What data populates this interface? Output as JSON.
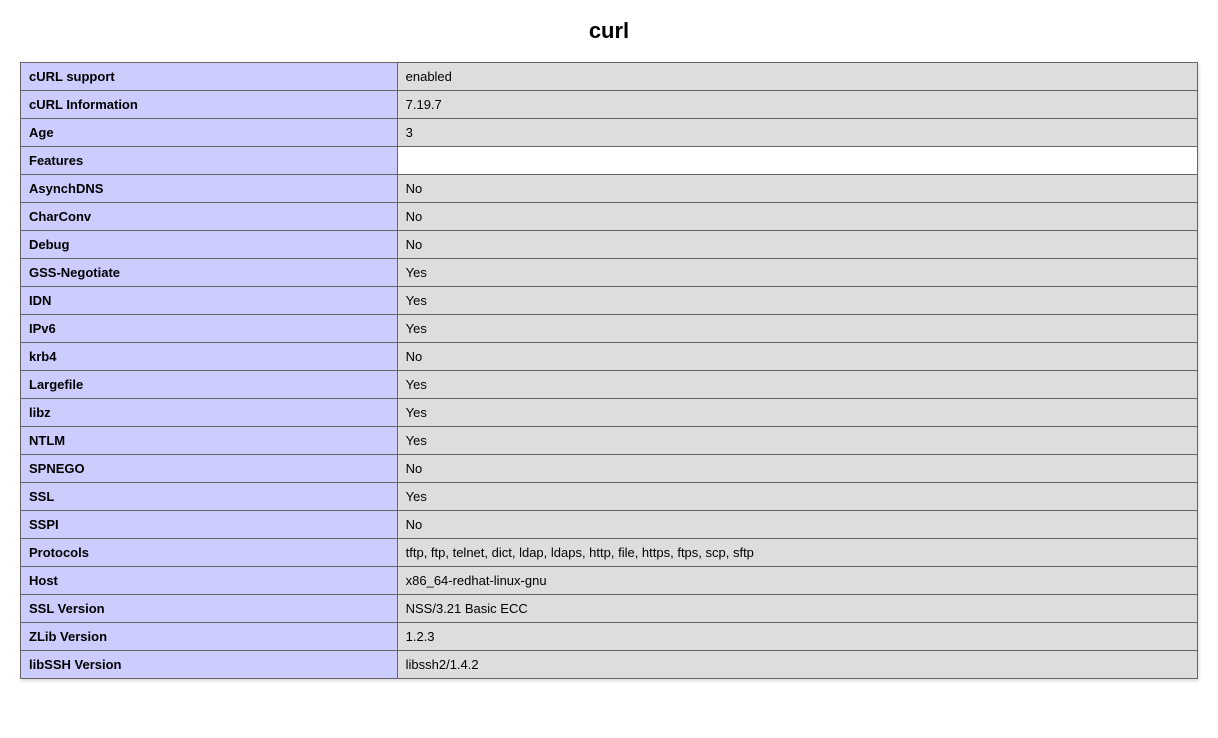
{
  "title": "curl",
  "rows": [
    {
      "key": "cURL support",
      "value": "enabled"
    },
    {
      "key": "cURL Information",
      "value": "7.19.7"
    },
    {
      "key": "Age",
      "value": "3"
    },
    {
      "key": "Features",
      "value": "",
      "empty": true
    },
    {
      "key": "AsynchDNS",
      "value": "No"
    },
    {
      "key": "CharConv",
      "value": "No"
    },
    {
      "key": "Debug",
      "value": "No"
    },
    {
      "key": "GSS-Negotiate",
      "value": "Yes"
    },
    {
      "key": "IDN",
      "value": "Yes"
    },
    {
      "key": "IPv6",
      "value": "Yes"
    },
    {
      "key": "krb4",
      "value": "No"
    },
    {
      "key": "Largefile",
      "value": "Yes"
    },
    {
      "key": "libz",
      "value": "Yes"
    },
    {
      "key": "NTLM",
      "value": "Yes"
    },
    {
      "key": "SPNEGO",
      "value": "No"
    },
    {
      "key": "SSL",
      "value": "Yes"
    },
    {
      "key": "SSPI",
      "value": "No"
    },
    {
      "key": "Protocols",
      "value": "tftp, ftp, telnet, dict, ldap, ldaps, http, file, https, ftps, scp, sftp"
    },
    {
      "key": "Host",
      "value": "x86_64-redhat-linux-gnu"
    },
    {
      "key": "SSL Version",
      "value": "NSS/3.21 Basic ECC"
    },
    {
      "key": "ZLib Version",
      "value": "1.2.3"
    },
    {
      "key": "libSSH Version",
      "value": "libssh2/1.4.2"
    }
  ]
}
